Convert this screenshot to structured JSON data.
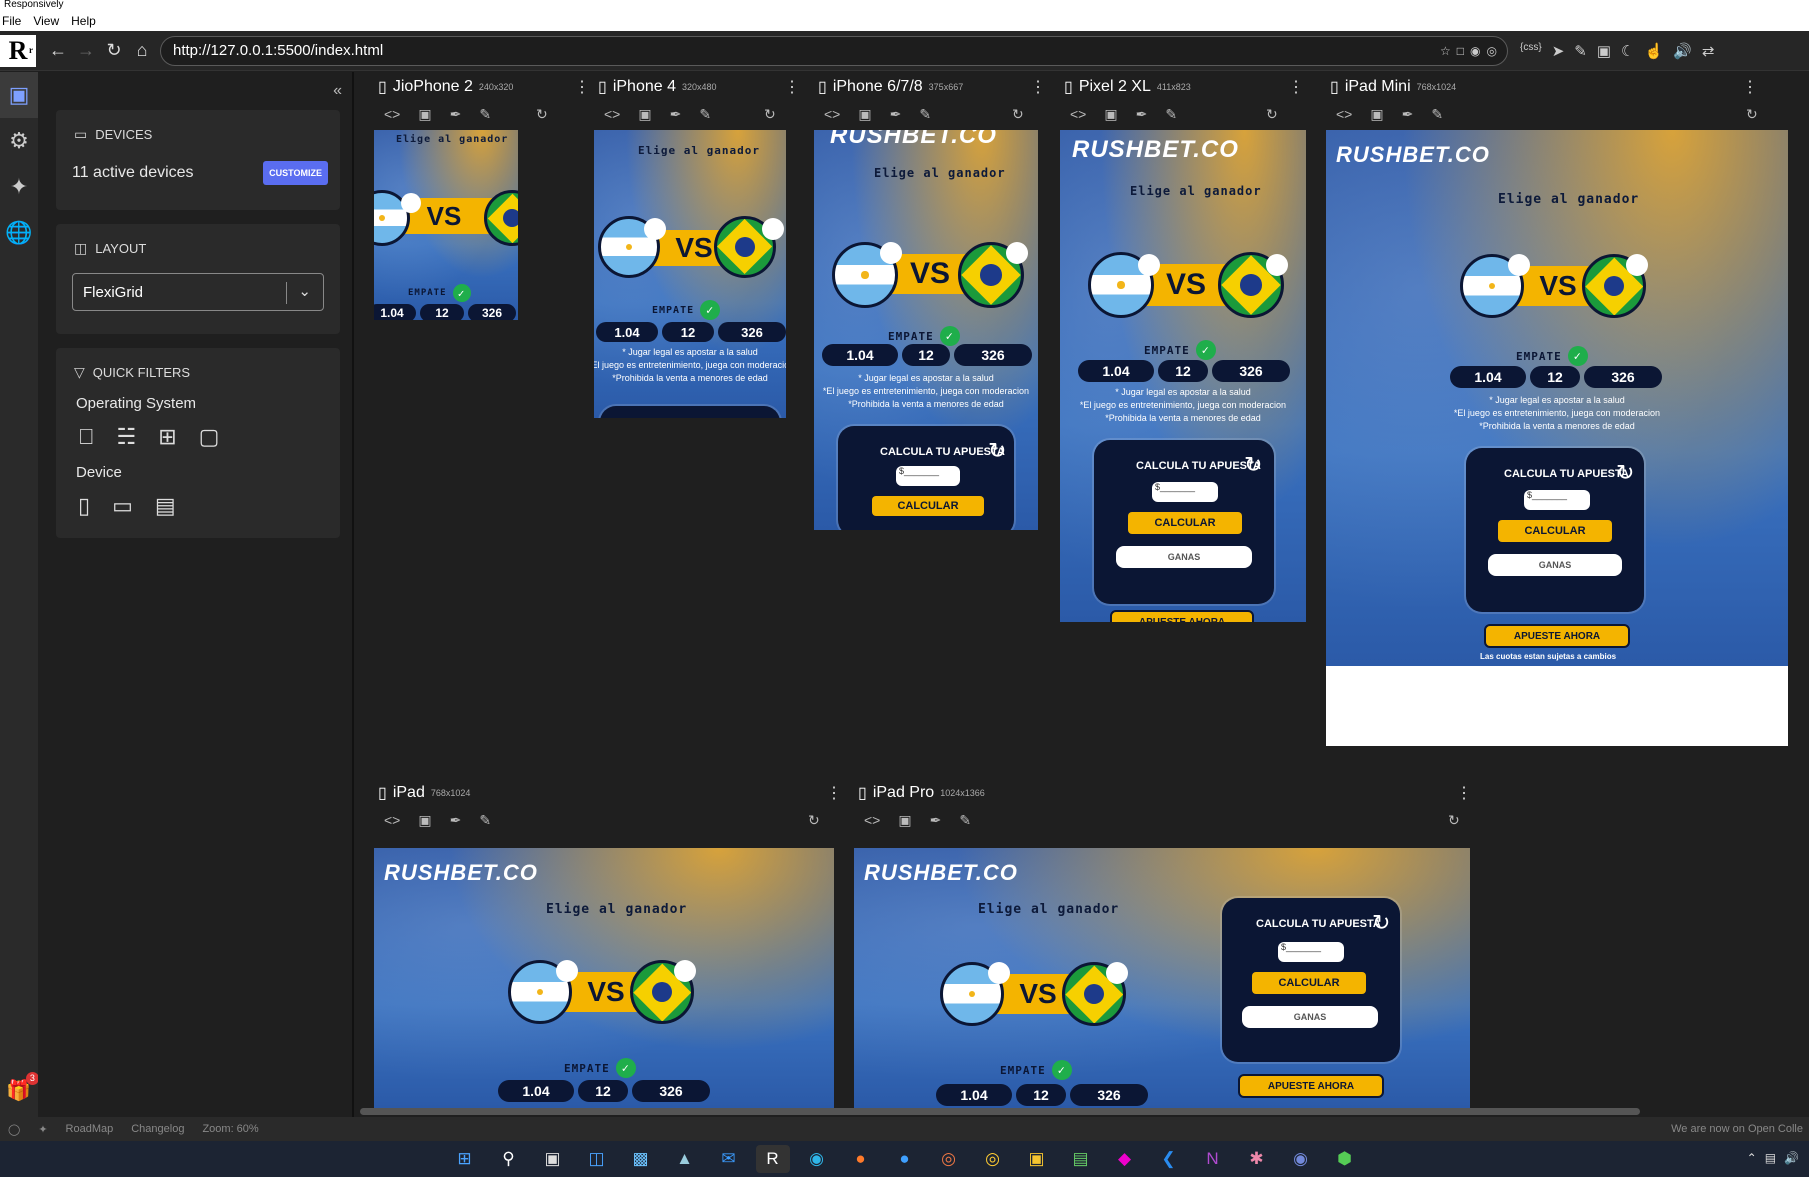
{
  "window": {
    "title": "Responsively"
  },
  "menu": [
    "File",
    "View",
    "Help"
  ],
  "address": {
    "url": "http://127.0.0.1:5500/index.html"
  },
  "sidebar": {
    "devices_title": "DEVICES",
    "active_devices": "11 active devices",
    "customize": "CUSTOMIZE",
    "layout_title": "LAYOUT",
    "layout_value": "FlexiGrid",
    "quick_filters_title": "QUICK FILTERS",
    "os_label": "Operating System",
    "device_label": "Device",
    "gift_badge": "3"
  },
  "status": {
    "roadmap": "RoadMap",
    "changelog": "Changelog",
    "zoom": "Zoom: 60%",
    "notice": "We are now on Open Colle"
  },
  "site": {
    "brand": "RUSHBET.CO",
    "elige": "Elige al ganador",
    "vs": "VS",
    "empate": "EMPATE",
    "odds": [
      "1.04",
      "12",
      "326"
    ],
    "legal1": "* Jugar legal es apostar a la salud",
    "legal2": "*El juego es entretenimiento, juega con moderacion",
    "legal3": "*Prohibida la venta a menores de edad",
    "calc_title": "CALCULA TU APUESTA",
    "calc_input": "$_______",
    "calcular": "CALCULAR",
    "ganas": "GANAS",
    "apueste": "APUESTE AHORA",
    "cuotas": "Las cuotas estan sujetas a cambios"
  },
  "devices": [
    {
      "name": "JioPhone 2",
      "size": "240x320"
    },
    {
      "name": "iPhone 4",
      "size": "320x480"
    },
    {
      "name": "iPhone 6/7/8",
      "size": "375x667"
    },
    {
      "name": "Pixel 2 XL",
      "size": "411x823"
    },
    {
      "name": "iPad Mini",
      "size": "768x1024"
    },
    {
      "name": "iPad",
      "size": "768x1024"
    },
    {
      "name": "iPad Pro",
      "size": "1024x1366"
    }
  ],
  "colors": {
    "accent": "#5a6df0",
    "brand_yellow": "#f4b400",
    "navy": "#0b1634",
    "site_blue": "#3468b8"
  }
}
